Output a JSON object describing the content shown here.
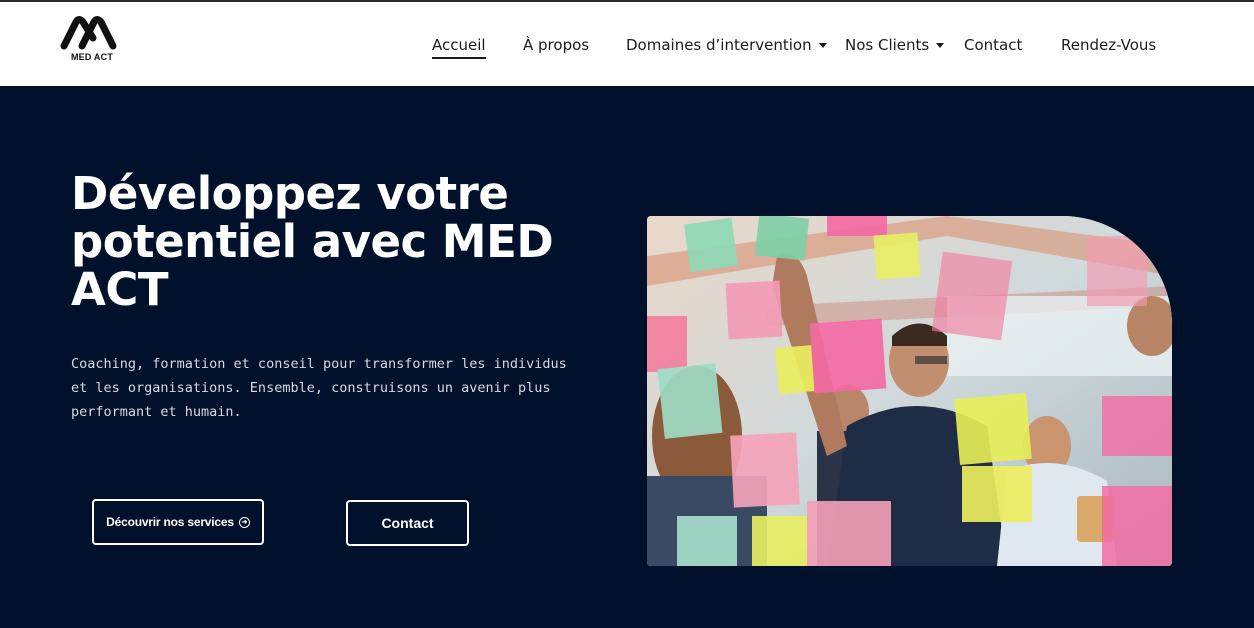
{
  "brand": {
    "name": "MED ACT"
  },
  "nav": {
    "items": [
      {
        "label": "Accueil",
        "active": true,
        "dropdown": false
      },
      {
        "label": "À propos",
        "active": false,
        "dropdown": false
      },
      {
        "label": "Domaines d’intervention",
        "active": false,
        "dropdown": true
      },
      {
        "label": "Nos Clients",
        "active": false,
        "dropdown": true
      },
      {
        "label": "Contact",
        "active": false,
        "dropdown": false
      },
      {
        "label": "Rendez-Vous",
        "active": false,
        "dropdown": false
      }
    ]
  },
  "hero": {
    "title": "Développez votre potentiel avec MED ACT",
    "subtitle": "Coaching, formation et conseil pour transformer les individus et les organisations. Ensemble, construisons un avenir plus performant et humain.",
    "primary_button": "Découvrir nos services",
    "secondary_button": "Contact",
    "image_icon": "team-sticky-notes-photo"
  },
  "colors": {
    "background": "#02112b",
    "header": "#ffffff",
    "text_dark": "#1b1b1b",
    "text_light": "#ffffff"
  }
}
